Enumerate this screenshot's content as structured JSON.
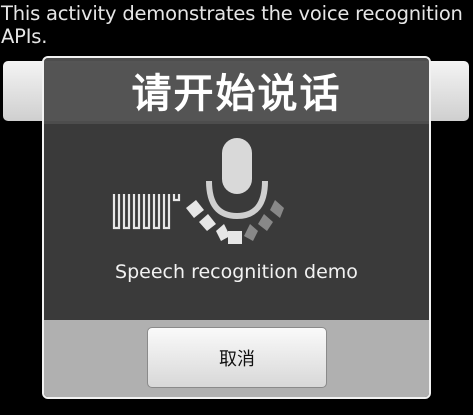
{
  "activity": {
    "description": "This activity demonstrates the voice recognition APIs."
  },
  "dialog": {
    "title": "请开始说话",
    "prompt": "Speech recognition demo",
    "cancel_label": "取消",
    "icons": [
      "microphone-icon",
      "sound-level-meter-icon",
      "volume-level-arc-icon"
    ]
  }
}
